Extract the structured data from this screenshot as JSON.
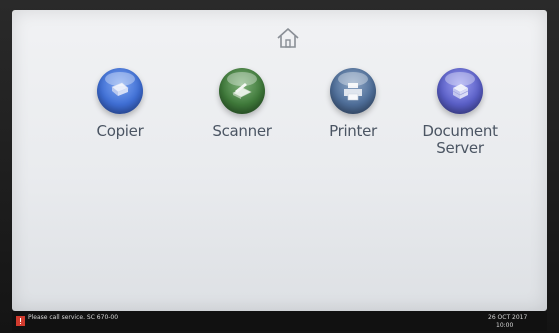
{
  "apps": [
    {
      "id": "copier",
      "label": "Copier",
      "icon": "copier-icon",
      "color": "#3f6fd6"
    },
    {
      "id": "scanner",
      "label": "Scanner",
      "icon": "scanner-icon",
      "color": "#3f7a3a"
    },
    {
      "id": "printer",
      "label": "Printer",
      "icon": "printer-icon",
      "color": "#4f6f9a"
    },
    {
      "id": "docserver",
      "label": "Document\nServer",
      "icon": "document-server-icon",
      "color": "#5a5fc8"
    }
  ],
  "status": {
    "message": "Please call service. SC 670-00",
    "date": "26 OCT 2017",
    "time": "10:00"
  }
}
